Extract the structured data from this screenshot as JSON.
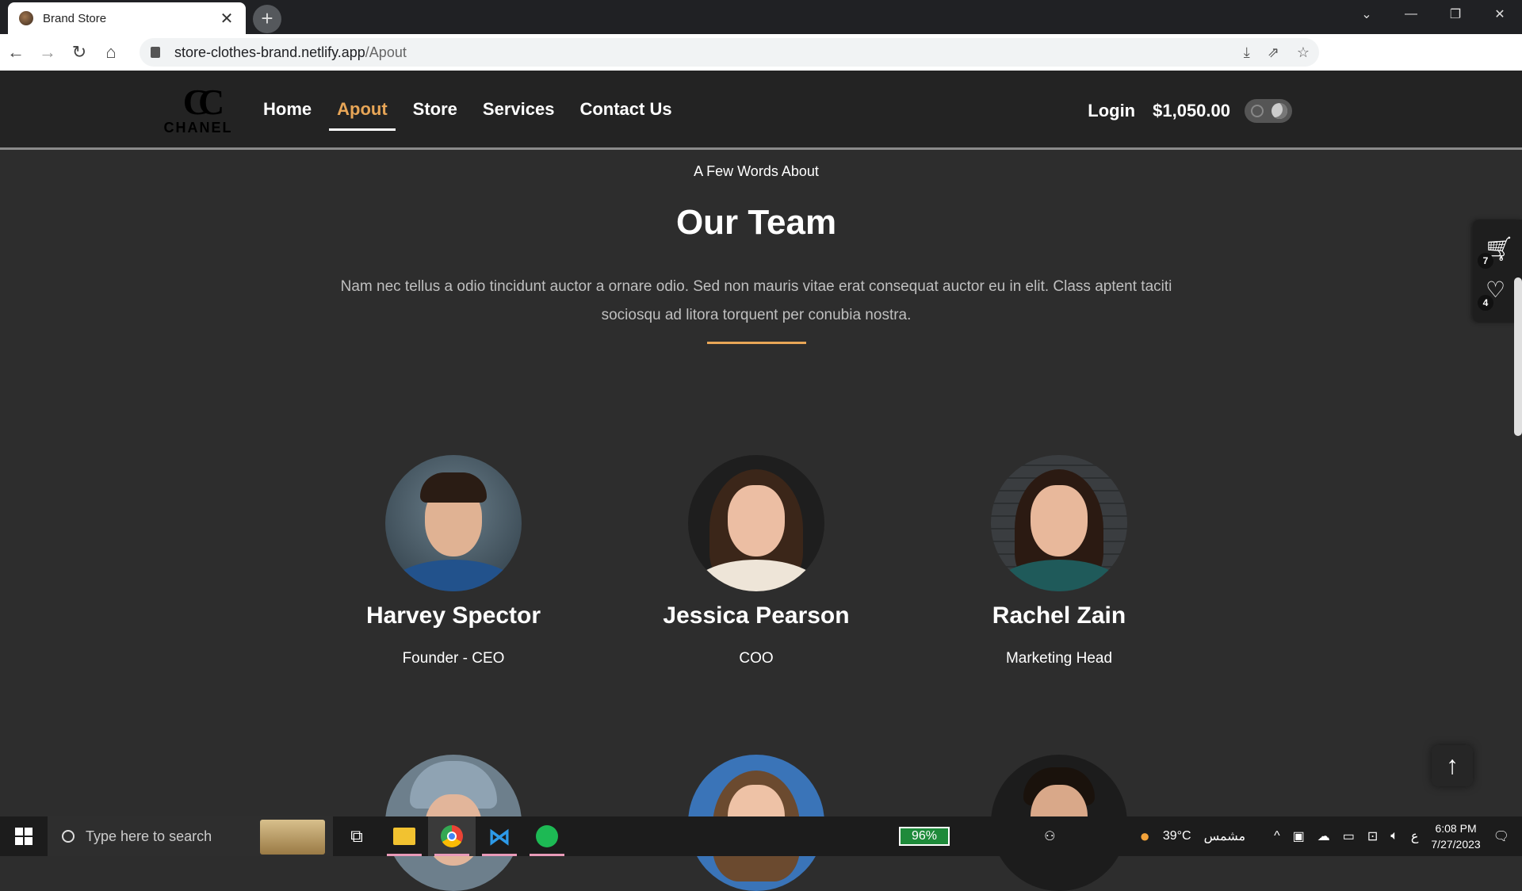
{
  "browser": {
    "tab_title": "Brand Store",
    "tab_close": "✕",
    "new_tab": "+",
    "url_host": "store-clothes-brand.netlify.app",
    "url_path": "/Apout",
    "window_controls": [
      "⌄",
      "—",
      "❐",
      "✕"
    ]
  },
  "site": {
    "logo_mark": "CC",
    "logo_text": "CHANEL",
    "nav": [
      "Home",
      "Apout",
      "Store",
      "Services",
      "Contact Us"
    ],
    "active_nav": "Apout",
    "login": "Login",
    "balance": "$1,050.00"
  },
  "about": {
    "eyebrow": "A Few Words About",
    "heading": "Our Team",
    "paragraph": "Nam nec tellus a odio tincidunt auctor a ornare odio. Sed non mauris vitae erat consequat auctor eu in elit. Class aptent taciti sociosqu ad litora torquent per conubia nostra.",
    "accent_color": "#e8a657",
    "members": [
      {
        "name": "Harvey Spector",
        "role": "Founder - CEO"
      },
      {
        "name": "Jessica Pearson",
        "role": "COO"
      },
      {
        "name": "Rachel Zain",
        "role": "Marketing Head"
      }
    ]
  },
  "side_panel": {
    "cart_count": "7",
    "wishlist_count": "4"
  },
  "taskbar": {
    "search_placeholder": "Type here to search",
    "battery": "96%",
    "weather": "39°C",
    "weather_label": "مشمس",
    "lang": "ع",
    "time": "6:08 PM",
    "date": "7/27/2023"
  }
}
